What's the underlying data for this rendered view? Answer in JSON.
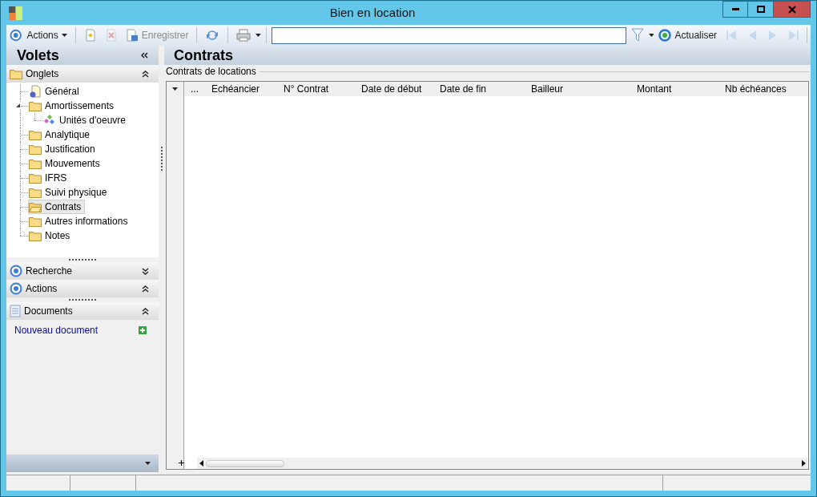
{
  "window": {
    "title": "Bien en location"
  },
  "toolbar": {
    "items": [
      {
        "kind": "menu",
        "label": "Actions",
        "disabled": false
      },
      {
        "kind": "new",
        "disabled": false
      },
      {
        "kind": "delete",
        "disabled": true
      },
      {
        "kind": "save",
        "label": "Enregistrer",
        "disabled": true
      },
      {
        "kind": "refresh",
        "disabled": false
      },
      {
        "kind": "print",
        "disabled": false
      }
    ],
    "right_items": [
      {
        "kind": "filter",
        "disabled": false
      },
      {
        "kind": "reload",
        "label": "Actualiser",
        "disabled": false
      },
      {
        "kind": "first",
        "disabled": true
      },
      {
        "kind": "prev",
        "disabled": true
      },
      {
        "kind": "next",
        "disabled": true
      },
      {
        "kind": "last",
        "disabled": true
      }
    ]
  },
  "sidebar": {
    "title": "Volets",
    "panes": [
      {
        "kind": "tree",
        "title": "Onglets",
        "expanded": true,
        "items": [
          {
            "label": "Général",
            "kind": "page",
            "selected": false
          },
          {
            "label": "Amortissements",
            "kind": "folder",
            "selected": false,
            "expanded": true,
            "children": [
              {
                "label": "Unités d'oeuvre",
                "kind": "diamond",
                "selected": false
              }
            ]
          },
          {
            "label": "Analytique",
            "kind": "folder",
            "selected": false
          },
          {
            "label": "Justification",
            "kind": "folder",
            "selected": false
          },
          {
            "label": "Mouvements",
            "kind": "folder",
            "selected": false
          },
          {
            "label": "IFRS",
            "kind": "folder",
            "selected": false
          },
          {
            "label": "Suivi physique",
            "kind": "folder",
            "selected": false
          },
          {
            "label": "Contrats",
            "kind": "folder",
            "selected": true
          },
          {
            "label": "Autres informations",
            "kind": "folder",
            "selected": false
          },
          {
            "label": "Notes",
            "kind": "folder",
            "selected": false
          }
        ]
      },
      {
        "kind": "radio",
        "title": "Recherche",
        "expanded": false
      },
      {
        "kind": "radio",
        "title": "Actions",
        "expanded": true
      },
      {
        "kind": "docs",
        "title": "Documents",
        "expanded": true,
        "links": [
          "Nouveau document"
        ]
      }
    ]
  },
  "main": {
    "title": "Contrats",
    "group": "Contrats de locations",
    "columns": [
      "...",
      "Echéancier",
      "N° Contrat",
      "Date de début",
      "Date de fin",
      "Bailleur",
      "Montant",
      "Nb échéances"
    ]
  }
}
